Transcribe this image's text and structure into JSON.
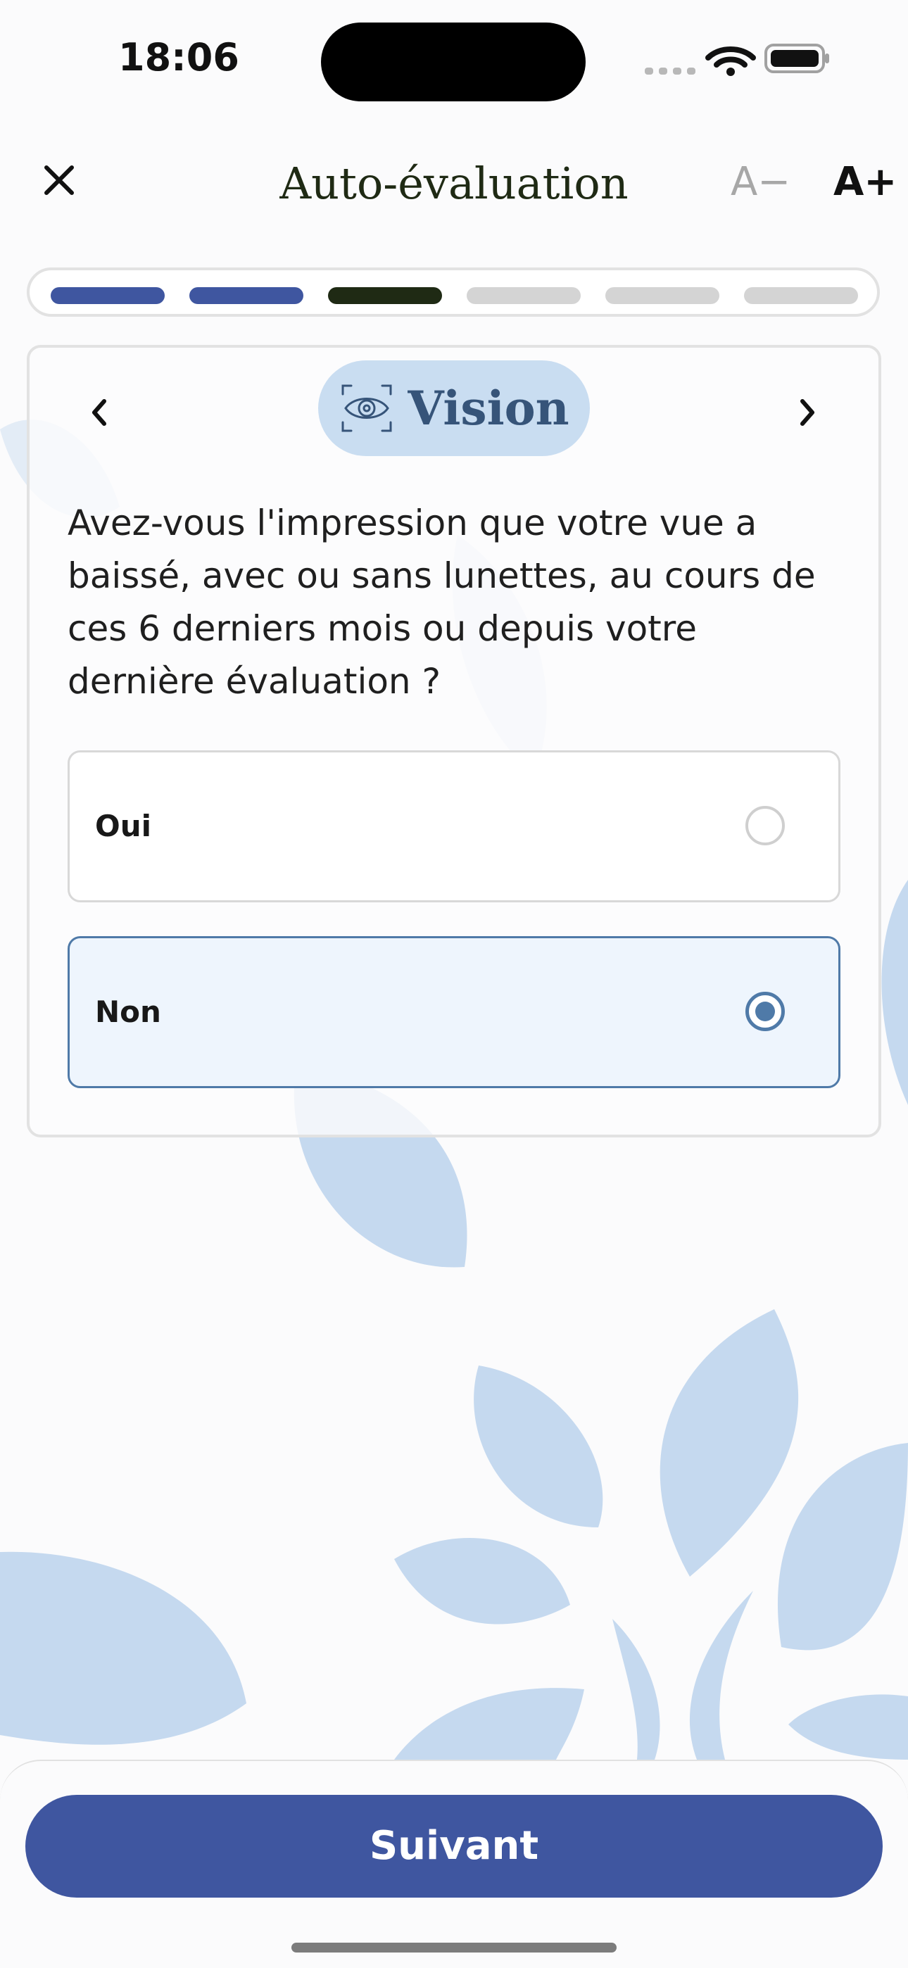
{
  "status_bar": {
    "time": "18:06"
  },
  "header": {
    "title": "Auto-évaluation",
    "font_decrease_label": "A−",
    "font_increase_label": "A+"
  },
  "progress": {
    "completed_color": "#3f56a0",
    "current_color": "#1f2a14",
    "pending_color": "#d4d4d4",
    "steps": [
      {
        "state": "completed"
      },
      {
        "state": "completed"
      },
      {
        "state": "current"
      },
      {
        "state": "pending"
      },
      {
        "state": "pending"
      },
      {
        "state": "pending"
      }
    ]
  },
  "question_card": {
    "category": "Vision",
    "category_icon": "eye-icon",
    "question": "Avez-vous l'impression que votre vue a baissé, avec ou sans lunettes, au cours de ces 6 derniers mois ou depuis votre dernière évaluation ?",
    "options": [
      {
        "label": "Oui",
        "selected": false
      },
      {
        "label": "Non",
        "selected": true
      }
    ]
  },
  "footer": {
    "next_label": "Suivant"
  },
  "colors": {
    "accent": "#3f56a0",
    "selected_border": "#4f7aa8",
    "selected_background": "#eef5fd",
    "pill_background": "#c9ddf1",
    "pill_text": "#365479",
    "leaf_decoration": "#c5d9ef"
  }
}
